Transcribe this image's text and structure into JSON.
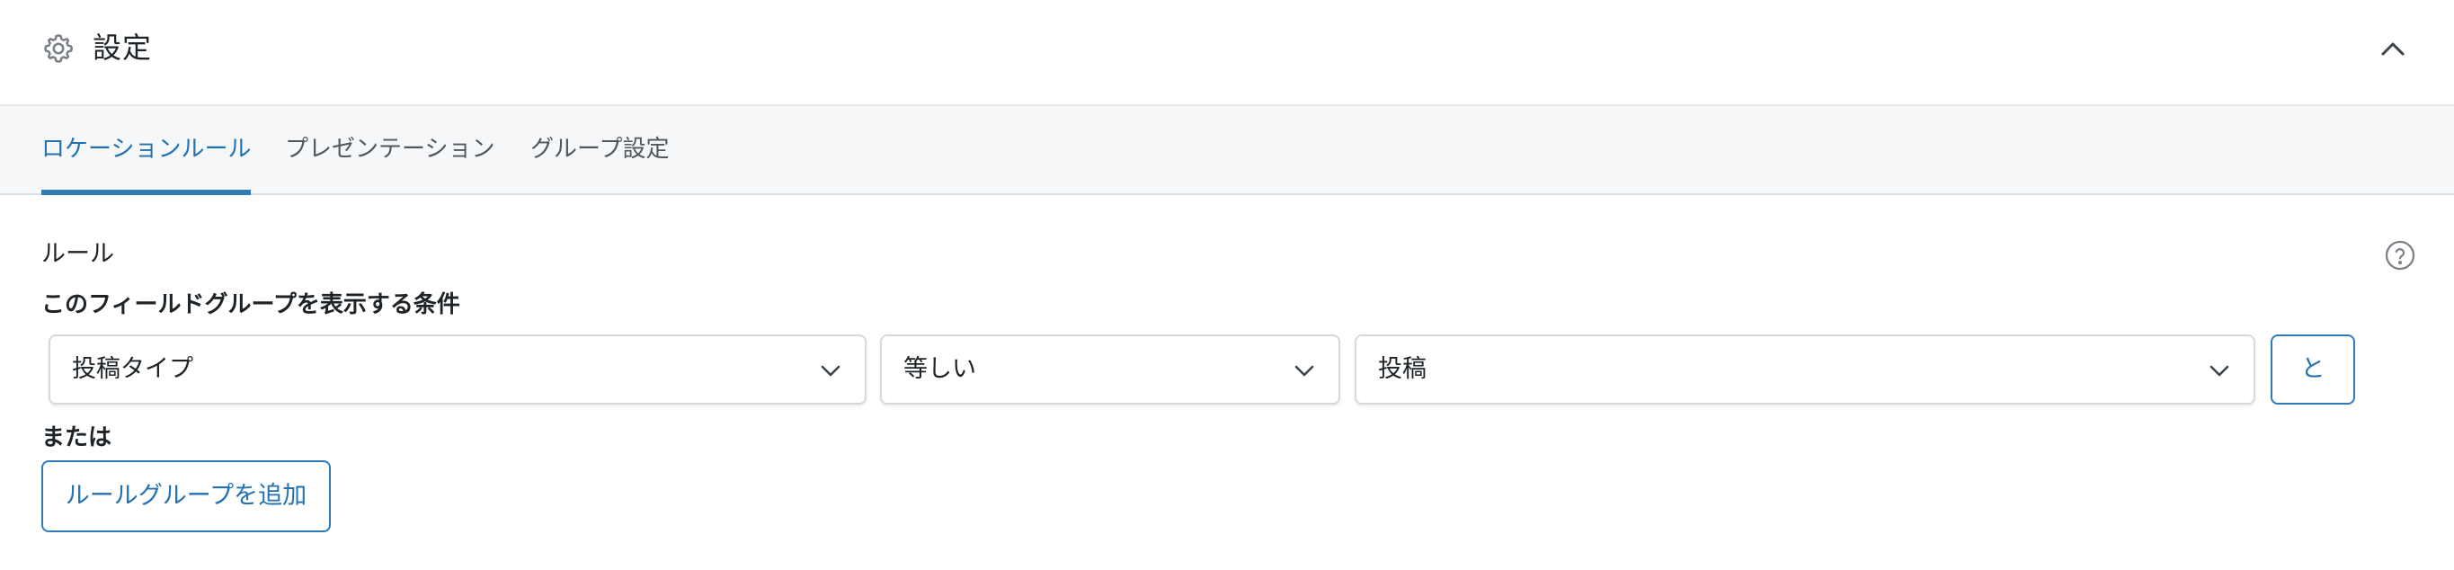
{
  "header": {
    "icon": "gear-icon",
    "title": "設定",
    "toggle_icon": "chevron-up-icon"
  },
  "tabs": [
    {
      "label": "ロケーションルール",
      "active": true
    },
    {
      "label": "プレゼンテーション",
      "active": false
    },
    {
      "label": "グループ設定",
      "active": false
    }
  ],
  "rules": {
    "label": "ルール",
    "help_icon": "question-circle-icon",
    "condition_heading": "このフィールドグループを表示する条件",
    "condition": {
      "param": "投稿タイプ",
      "operator": "等しい",
      "value": "投稿"
    },
    "and_button": "と",
    "or_label": "または",
    "add_group_button": "ルールグループを追加"
  },
  "colors": {
    "accent": "#2271b1",
    "tab_bar_bg": "#f6f7f9",
    "text": "#1d2327"
  }
}
